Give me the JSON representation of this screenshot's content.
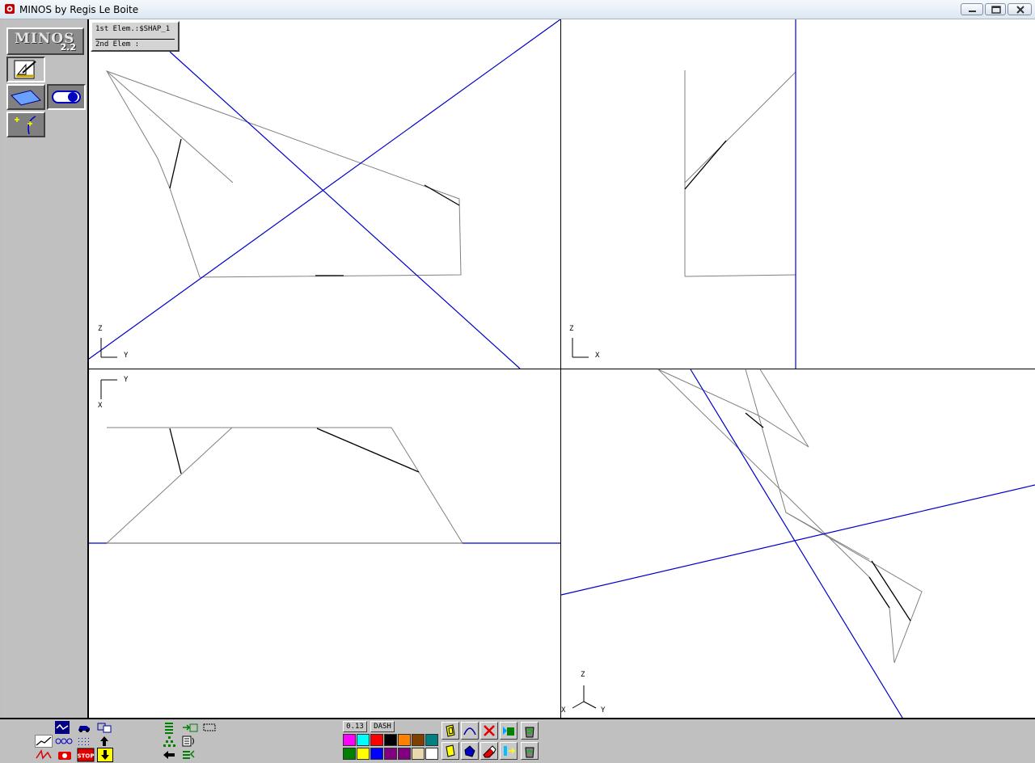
{
  "window": {
    "title": "MINOS by Regis Le Boite",
    "controls": [
      "minimize",
      "maximize",
      "close"
    ]
  },
  "logo": {
    "title": "MINOS",
    "version": "2.2"
  },
  "element_info": {
    "first_label": "1st Elem.:",
    "first_value": "$SHAP_1",
    "second_label": "2nd Elem :",
    "second_value": ""
  },
  "views": {
    "top_left": {
      "axis_v": "Z",
      "axis_h": "Y"
    },
    "top_right": {
      "axis_v": "Z",
      "axis_h": "X"
    },
    "bottom_left": {
      "axis_v": "X",
      "axis_h": "Y"
    },
    "bottom_right": {
      "axis_up": "Z",
      "axis_left": "X",
      "axis_right": "Y"
    }
  },
  "line_settings": {
    "width": "0.13",
    "style": "DASH"
  },
  "palette": {
    "row1": [
      "#ff00ff",
      "#00ffff",
      "#ff0000",
      "#000000",
      "#ff8000",
      "#804000",
      "#008080"
    ],
    "row2": [
      "#008000",
      "#ffff00",
      "#0000ff",
      "#800080",
      "#800080",
      "#e8d8b0",
      "#ffffff"
    ]
  },
  "colors": {
    "geometry": "#808080",
    "edge": "#000000",
    "plane": "#0000cc",
    "viewport_bg": "#ffffff",
    "panel_bg": "#c0c0c0"
  },
  "icons": {
    "left_tools": [
      "sketch-tool-icon",
      "plane-icon",
      "toggle-icon",
      "curve-points-icon"
    ],
    "bottom_left": [
      "wave-icon",
      "car-icon",
      "windows-icon",
      "trend-icon",
      "chain-icon",
      "dots-icon",
      "up-arrow-icon",
      "red-scribble-icon",
      "camera-icon",
      "stop-icon",
      "down-arrow-icon"
    ],
    "bottom_mid": [
      "stack-icon",
      "export-icon",
      "frame-icon",
      "tree-icon",
      "list-icon",
      "left-arrow-icon",
      "import-icon"
    ],
    "bottom_right": [
      "yellow-box-icon",
      "arc-icon",
      "delete-icon",
      "green-stack-icon",
      "recycle-icon",
      "yellow-box-2-icon",
      "blue-shape-icon",
      "eraser-icon",
      "insert-icon",
      "recycle-2-icon"
    ]
  }
}
